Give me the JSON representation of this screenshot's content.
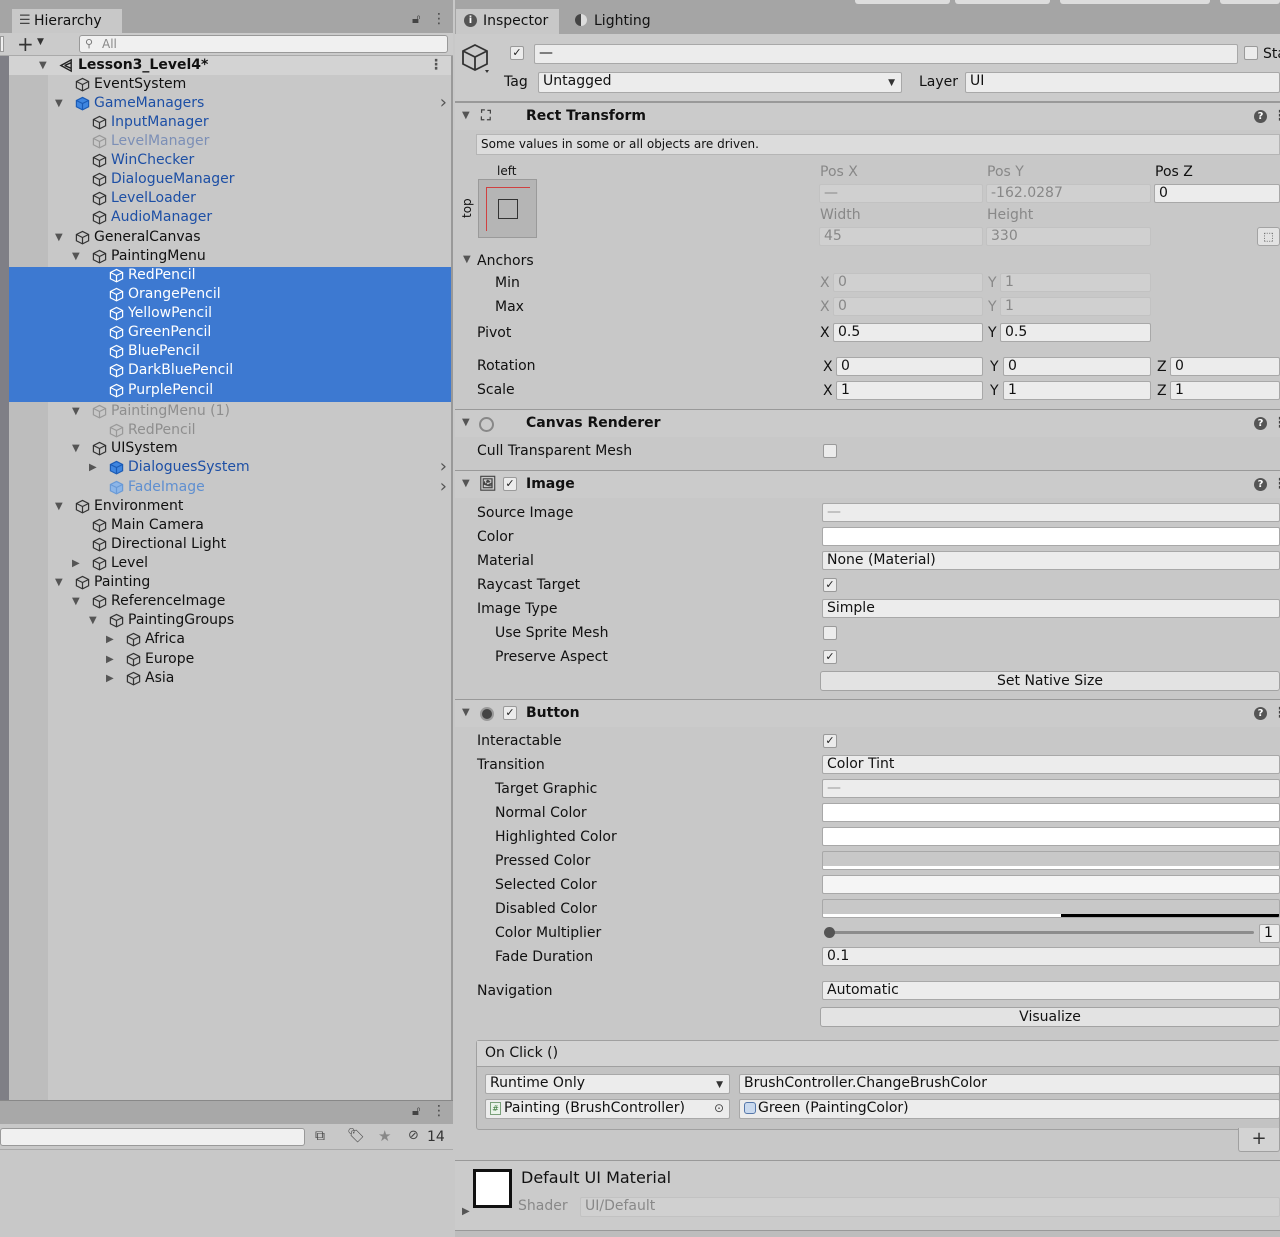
{
  "hierarchy": {
    "tab_label": "Hierarchy",
    "search_placeholder": "All",
    "rows": [
      {
        "label": "Lesson3_Level4*"
      },
      {
        "label": "EventSystem"
      },
      {
        "label": "GameManagers"
      },
      {
        "label": "InputManager"
      },
      {
        "label": "LevelManager"
      },
      {
        "label": "WinChecker"
      },
      {
        "label": "DialogueManager"
      },
      {
        "label": "LevelLoader"
      },
      {
        "label": "AudioManager"
      },
      {
        "label": "GeneralCanvas"
      },
      {
        "label": "PaintingMenu"
      },
      {
        "label": "RedPencil"
      },
      {
        "label": "OrangePencil"
      },
      {
        "label": "YellowPencil"
      },
      {
        "label": "GreenPencil"
      },
      {
        "label": "BluePencil"
      },
      {
        "label": "DarkBluePencil"
      },
      {
        "label": "PurplePencil"
      },
      {
        "label": "PaintingMenu (1)"
      },
      {
        "label": "RedPencil"
      },
      {
        "label": "UISystem"
      },
      {
        "label": "DialoguesSystem"
      },
      {
        "label": "FadeImage"
      },
      {
        "label": "Environment"
      },
      {
        "label": "Main Camera"
      },
      {
        "label": "Directional Light"
      },
      {
        "label": "Level"
      },
      {
        "label": "Painting"
      },
      {
        "label": "ReferenceImage"
      },
      {
        "label": "PaintingGroups"
      },
      {
        "label": "Africa"
      },
      {
        "label": "Europe"
      },
      {
        "label": "Asia"
      }
    ],
    "hidden_count": "14"
  },
  "inspector": {
    "tabs": {
      "inspector": "Inspector",
      "lighting": "Lighting"
    },
    "object": {
      "name_value": "—",
      "static_label": "Sta",
      "tag_label": "Tag",
      "tag_value": "Untagged",
      "layer_label": "Layer",
      "layer_value": "UI"
    },
    "rect_transform": {
      "title": "Rect Transform",
      "notice": "Some values in some or all objects are driven.",
      "anchor_left": "left",
      "anchor_top": "top",
      "posx_label": "Pos X",
      "posx_value": "—",
      "posy_label": "Pos Y",
      "posy_value": "-162.0287",
      "posz_label": "Pos Z",
      "posz_value": "0",
      "width_label": "Width",
      "width_value": "45",
      "height_label": "Height",
      "height_value": "330",
      "anchors_label": "Anchors",
      "min_label": "Min",
      "min_x": "0",
      "min_y": "1",
      "max_label": "Max",
      "max_x": "0",
      "max_y": "1",
      "pivot_label": "Pivot",
      "pivot_x": "0.5",
      "pivot_y": "0.5",
      "rotation_label": "Rotation",
      "rot_x": "0",
      "rot_y": "0",
      "rot_z": "0",
      "scale_label": "Scale",
      "scale_x": "1",
      "scale_y": "1",
      "scale_z": "1"
    },
    "canvas_renderer": {
      "title": "Canvas Renderer",
      "cull_label": "Cull Transparent Mesh",
      "cull_checked": false
    },
    "image": {
      "title": "Image",
      "source_image_label": "Source Image",
      "source_image_value": "—",
      "color_label": "Color",
      "material_label": "Material",
      "material_value": "None (Material)",
      "raycast_label": "Raycast Target",
      "raycast_checked": true,
      "image_type_label": "Image Type",
      "image_type_value": "Simple",
      "use_sprite_mesh_label": "Use Sprite Mesh",
      "use_sprite_mesh_checked": false,
      "preserve_aspect_label": "Preserve Aspect",
      "preserve_aspect_checked": true,
      "set_native_size": "Set Native Size"
    },
    "button": {
      "title": "Button",
      "interactable_label": "Interactable",
      "interactable_checked": true,
      "transition_label": "Transition",
      "transition_value": "Color Tint",
      "target_graphic_label": "Target Graphic",
      "target_graphic_value": "—",
      "normal_color_label": "Normal Color",
      "highlighted_color_label": "Highlighted Color",
      "pressed_color_label": "Pressed Color",
      "selected_color_label": "Selected Color",
      "disabled_color_label": "Disabled Color",
      "color_multiplier_label": "Color Multiplier",
      "color_multiplier_value": "1",
      "color_multiplier_fraction": 0.0,
      "fade_duration_label": "Fade Duration",
      "fade_duration_value": "0.1",
      "navigation_label": "Navigation",
      "navigation_value": "Automatic",
      "visualize": "Visualize",
      "onclick_title": "On Click ()",
      "runtime_value": "Runtime Only",
      "function_value": "BrushController.ChangeBrushColor",
      "object_value": "Painting (BrushController)",
      "argument_value": "Green (PaintingColor)"
    },
    "material": {
      "title": "Default UI Material",
      "shader_label": "Shader",
      "shader_value": "UI/Default"
    }
  },
  "colors": {
    "selection": "#3d79d1",
    "prefab_text": "#1d4fa5",
    "panel_bg": "#c8c8c8"
  }
}
